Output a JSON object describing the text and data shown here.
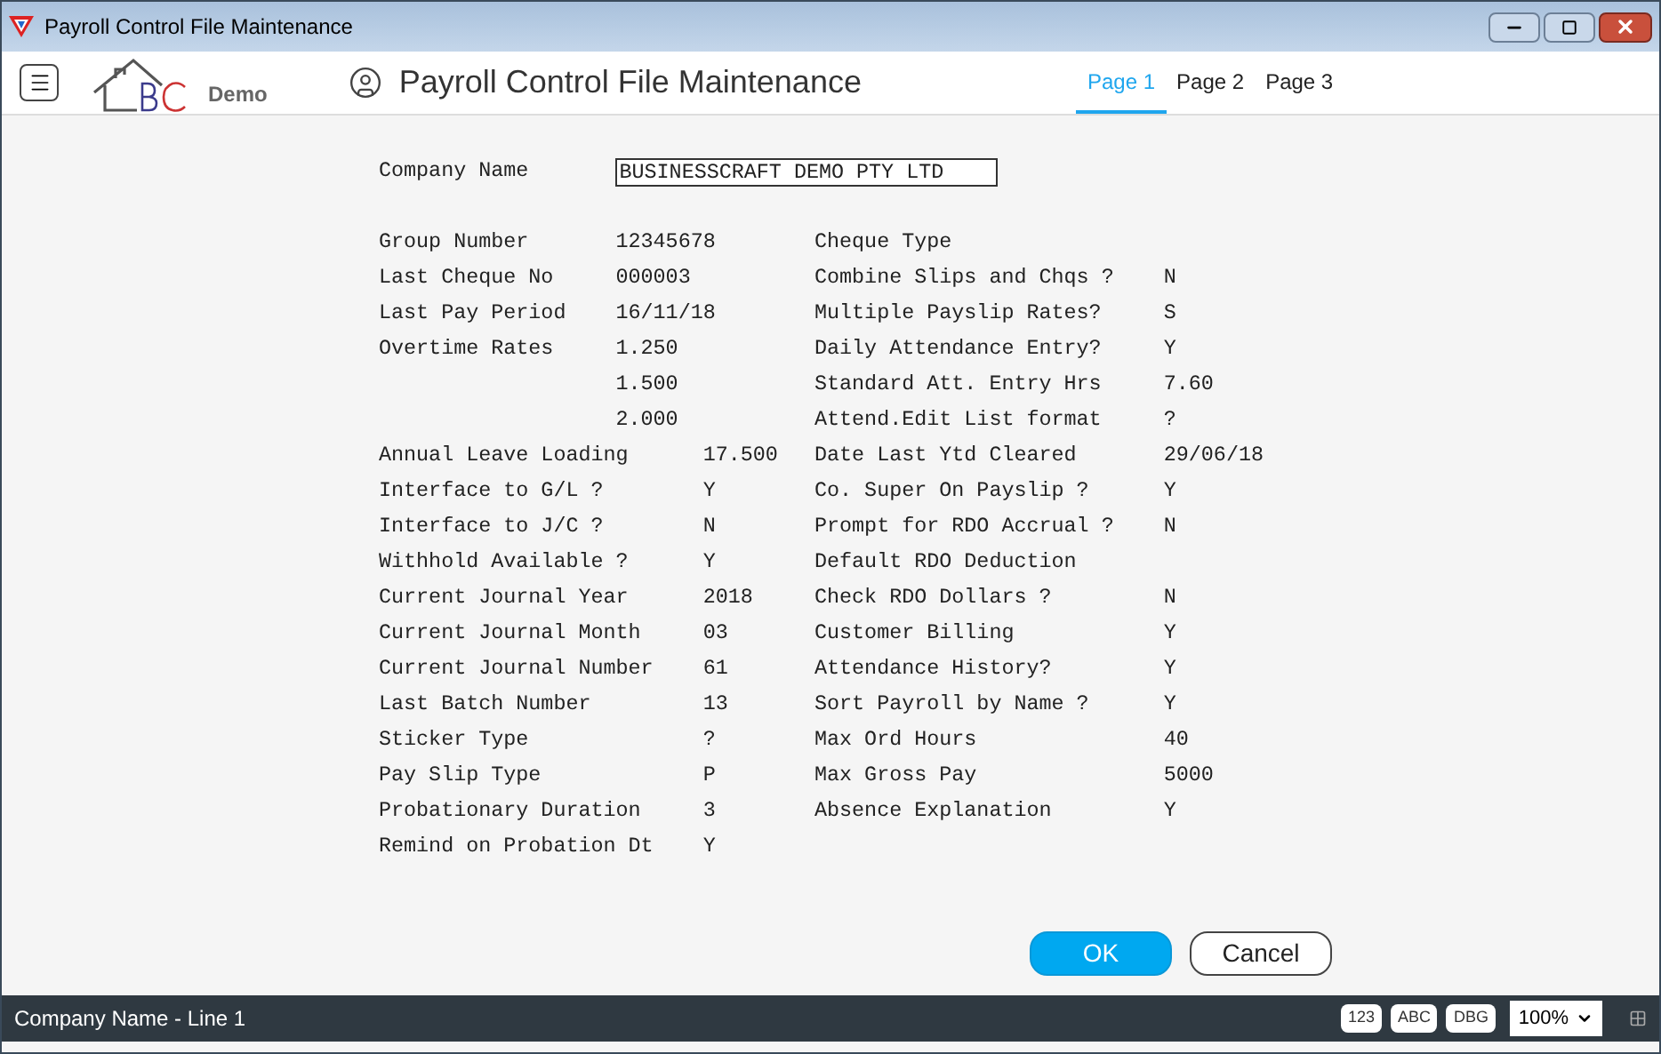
{
  "window": {
    "title": "Payroll Control File Maintenance"
  },
  "header": {
    "logo_text": "Demo",
    "title": "Payroll Control File Maintenance"
  },
  "tabs": [
    {
      "label": "Page 1",
      "selected": true
    },
    {
      "label": "Page 2",
      "selected": false
    },
    {
      "label": "Page 3",
      "selected": false
    }
  ],
  "company_name": {
    "label": "Company Name",
    "value": "BUSINESSCRAFT DEMO PTY LTD"
  },
  "left_fields": [
    {
      "label": "Group Number",
      "value": "12345678",
      "kind": "short"
    },
    {
      "label": "Last Cheque No",
      "value": "000003",
      "kind": "short"
    },
    {
      "label": "Last Pay Period",
      "value": "16/11/18",
      "kind": "short"
    },
    {
      "label": "Overtime Rates",
      "value": "1.250",
      "kind": "short"
    },
    {
      "value": "1.500",
      "kind": "short"
    },
    {
      "value": "2.000",
      "kind": "short"
    },
    {
      "label": "Annual Leave Loading",
      "value": "17.500",
      "kind": "long"
    },
    {
      "label": "Interface to G/L ?",
      "value": "Y",
      "kind": "long"
    },
    {
      "label": "Interface to J/C ?",
      "value": "N",
      "kind": "long"
    },
    {
      "label": "Withhold Available ?",
      "value": "Y",
      "kind": "long"
    },
    {
      "label": "Current Journal Year",
      "value": "2018",
      "kind": "long"
    },
    {
      "label": "Current Journal Month",
      "value": "03",
      "kind": "long"
    },
    {
      "label": "Current Journal Number",
      "value": "61",
      "kind": "long"
    },
    {
      "label": "Last Batch Number",
      "value": "13",
      "kind": "long"
    },
    {
      "label": "Sticker Type",
      "value": "?",
      "kind": "long"
    },
    {
      "label": "Pay Slip Type",
      "value": "P",
      "kind": "long"
    },
    {
      "label": "Probationary Duration",
      "value": "3",
      "kind": "long"
    },
    {
      "label": "Remind on Probation Dt",
      "value": "Y",
      "kind": "long"
    }
  ],
  "right_fields": [
    {
      "label": "Cheque Type"
    },
    {
      "label": "Combine Slips and Chqs ?",
      "value": "N"
    },
    {
      "label": "Multiple Payslip Rates?",
      "value": "S"
    },
    {
      "label": "Daily Attendance Entry?",
      "value": "Y"
    },
    {
      "label": "Standard Att. Entry Hrs",
      "value": "7.60"
    },
    {
      "label": "Attend.Edit List format",
      "value": "?"
    },
    {
      "label": "Date Last Ytd Cleared",
      "value": "29/06/18"
    },
    {
      "label": "Co. Super On Payslip ?",
      "value": "Y"
    },
    {
      "label": "Prompt for RDO Accrual ?",
      "value": "N"
    },
    {
      "label": "Default RDO Deduction"
    },
    {
      "label": "Check RDO Dollars ?",
      "value": "N"
    },
    {
      "label": "Customer Billing",
      "value": "Y"
    },
    {
      "label": "Attendance History?",
      "value": "Y"
    },
    {
      "label": "Sort Payroll by Name ?",
      "value": "Y"
    },
    {
      "label": "Max Ord Hours",
      "value": "40"
    },
    {
      "label": "Max Gross Pay",
      "value": "5000"
    },
    {
      "label": "Absence Explanation",
      "value": "Y"
    }
  ],
  "buttons": [
    {
      "label": "OK",
      "kind": "primary"
    },
    {
      "label": "Cancel",
      "kind": "secondary"
    }
  ],
  "status_bar": {
    "text": "Company Name - Line 1",
    "modes": [
      "123",
      "ABC",
      "DBG"
    ],
    "zoom": "100%"
  }
}
